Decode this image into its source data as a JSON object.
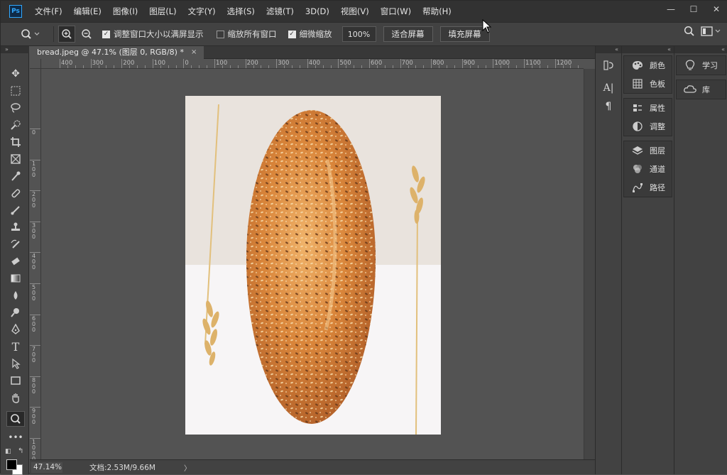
{
  "app": {
    "logo_text": "Ps"
  },
  "menu": [
    "文件(F)",
    "编辑(E)",
    "图像(I)",
    "图层(L)",
    "文字(Y)",
    "选择(S)",
    "滤镜(T)",
    "3D(D)",
    "视图(V)",
    "窗口(W)",
    "帮助(H)"
  ],
  "window_controls": {
    "minimize": "—",
    "maximize": "☐",
    "close": "✕"
  },
  "options_bar": {
    "tool_icon": "zoom-icon",
    "checkbox_resize": {
      "label": "调整窗口大小以满屏显示",
      "checked": true
    },
    "checkbox_zoom_all": {
      "label": "缩放所有窗口",
      "checked": false
    },
    "checkbox_scrubby": {
      "label": "细微缩放",
      "checked": true
    },
    "zoom_100": "100%",
    "fit_screen": "适合屏幕",
    "fill_screen": "填充屏幕"
  },
  "document_tab": {
    "title": "bread.jpeg @ 47.1% (图层 0, RGB/8) *",
    "close": "×"
  },
  "ruler_h_labels": [
    "400",
    "300",
    "200",
    "100",
    "0",
    "100",
    "200",
    "300",
    "400",
    "500",
    "600",
    "700",
    "800",
    "900",
    "1000",
    "1100",
    "1200"
  ],
  "ruler_v_labels": [
    "0",
    "100",
    "200",
    "300",
    "400",
    "500",
    "600",
    "700",
    "800",
    "900",
    "1000"
  ],
  "status_bar": {
    "zoom": "47.14%",
    "doc_info": "文档:2.53M/9.66M",
    "arrow": "〉"
  },
  "panels": {
    "group1": [
      {
        "label": "颜色",
        "icon": "color-palette-icon"
      },
      {
        "label": "色板",
        "icon": "swatches-grid-icon"
      }
    ],
    "group2": [
      {
        "label": "属性",
        "icon": "properties-icon"
      },
      {
        "label": "调整",
        "icon": "adjustments-icon"
      }
    ],
    "group3": [
      {
        "label": "图层",
        "icon": "layers-icon"
      },
      {
        "label": "通道",
        "icon": "channels-icon"
      },
      {
        "label": "路径",
        "icon": "paths-icon"
      }
    ],
    "learn": {
      "label": "学习",
      "icon": "lightbulb-icon"
    },
    "library": {
      "label": "库",
      "icon": "libraries-icon"
    }
  },
  "toolbar_tools": [
    "move-tool",
    "marquee-tool",
    "lasso-tool",
    "quick-select-tool",
    "crop-tool",
    "frame-tool",
    "eyedropper-tool",
    "healing-brush-tool",
    "brush-tool",
    "clone-stamp-tool",
    "history-brush-tool",
    "eraser-tool",
    "gradient-tool",
    "blur-tool",
    "dodge-tool",
    "pen-tool",
    "type-tool",
    "path-select-tool",
    "rectangle-tool",
    "hand-tool",
    "zoom-tool",
    "more-tools"
  ]
}
